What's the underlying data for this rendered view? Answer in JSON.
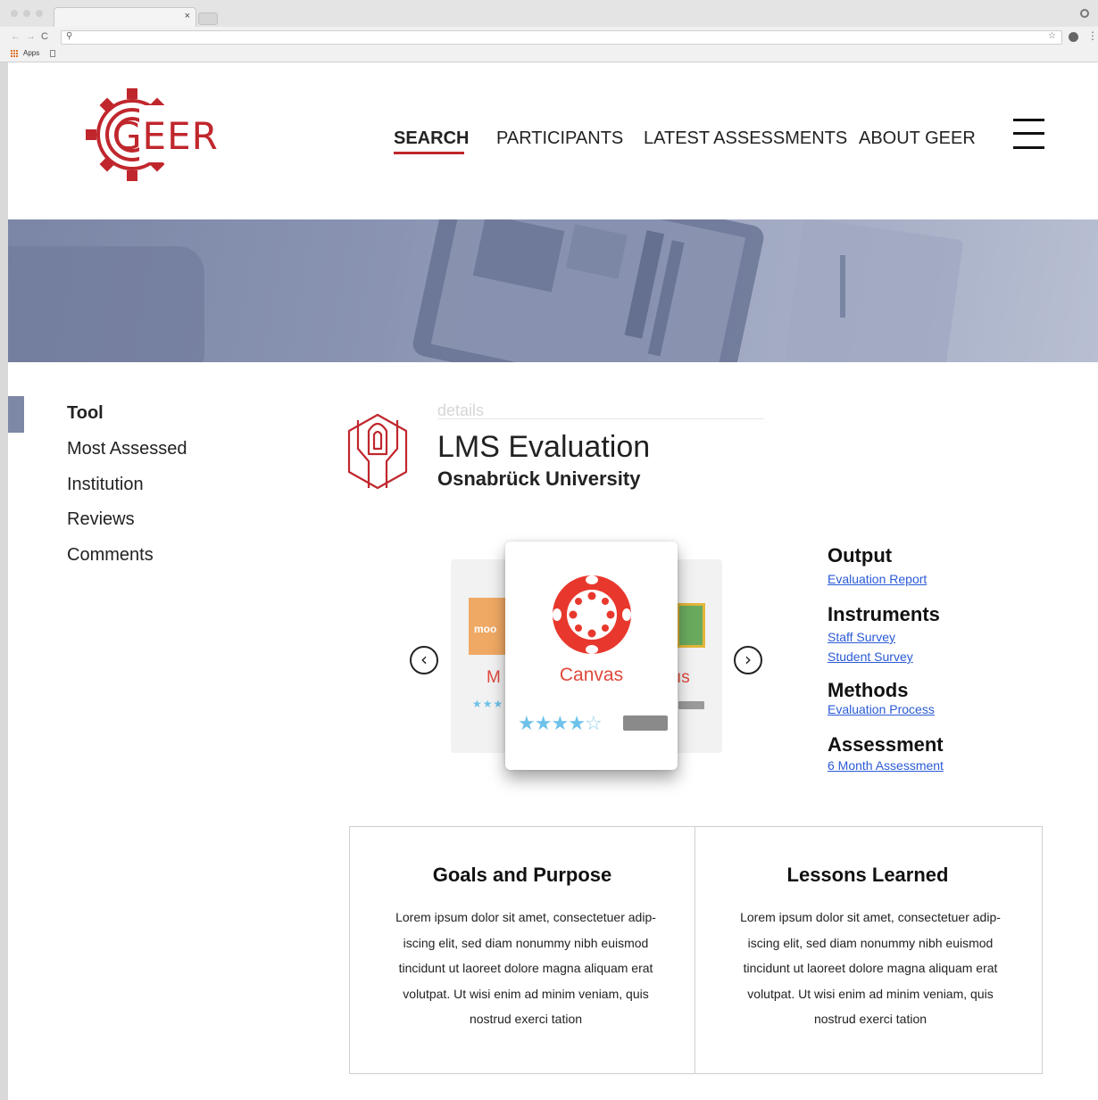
{
  "browser": {
    "bookmarks": {
      "apps_label": "Apps"
    }
  },
  "header": {
    "logo_text": "GEER",
    "nav": [
      {
        "label": "SEARCH",
        "active": true
      },
      {
        "label": "PARTICIPANTS",
        "active": false
      },
      {
        "label": "LATEST ASSESSMENTS",
        "active": false
      },
      {
        "label": "ABOUT GEER",
        "active": false
      }
    ],
    "accent_color": "#c0272d"
  },
  "sidebar": {
    "items": [
      {
        "label": "Tool",
        "active": true
      },
      {
        "label": "Most Assessed",
        "active": false
      },
      {
        "label": "Institution",
        "active": false
      },
      {
        "label": "Reviews",
        "active": false
      },
      {
        "label": "Comments",
        "active": false
      }
    ]
  },
  "detail": {
    "section_label": "details",
    "title": "LMS Evaluation",
    "institution": "Osnabrück University"
  },
  "carousel": {
    "prev_icon": "chevron-left-icon",
    "next_icon": "chevron-right-icon",
    "left_card": {
      "logo_text": "moo",
      "name_fragment": "M",
      "rating": 3
    },
    "active_card": {
      "name": "Canvas",
      "rating": 4,
      "max_rating": 5
    },
    "right_card": {
      "name_fragment": "ıs"
    }
  },
  "meta": {
    "sections": [
      {
        "heading": "Output",
        "links": [
          "Evaluation Report"
        ]
      },
      {
        "heading": "Instruments",
        "links": [
          "Staff Survey",
          "Student Survey"
        ]
      },
      {
        "heading": "Methods",
        "links": [
          "Evaluation Process"
        ]
      },
      {
        "heading": "Assessment",
        "links": [
          "6 Month Assessment"
        ]
      }
    ]
  },
  "boxes": [
    {
      "title": "Goals and Purpose",
      "lines": [
        "Lorem ipsum dolor sit amet, consectetuer adip-",
        "iscing elit, sed diam nonummy nibh euismod",
        "tincidunt ut laoreet dolore magna aliquam erat",
        "volutpat. Ut wisi enim ad minim veniam, quis",
        "nostrud exerci tation"
      ]
    },
    {
      "title": "Lessons Learned",
      "lines": [
        "Lorem ipsum dolor sit amet, consectetuer adip-",
        "iscing elit, sed diam nonummy nibh euismod",
        "tincidunt ut laoreet dolore magna aliquam erat",
        "volutpat. Ut wisi enim ad minim veniam, quis",
        "nostrud exerci tation"
      ]
    }
  ]
}
